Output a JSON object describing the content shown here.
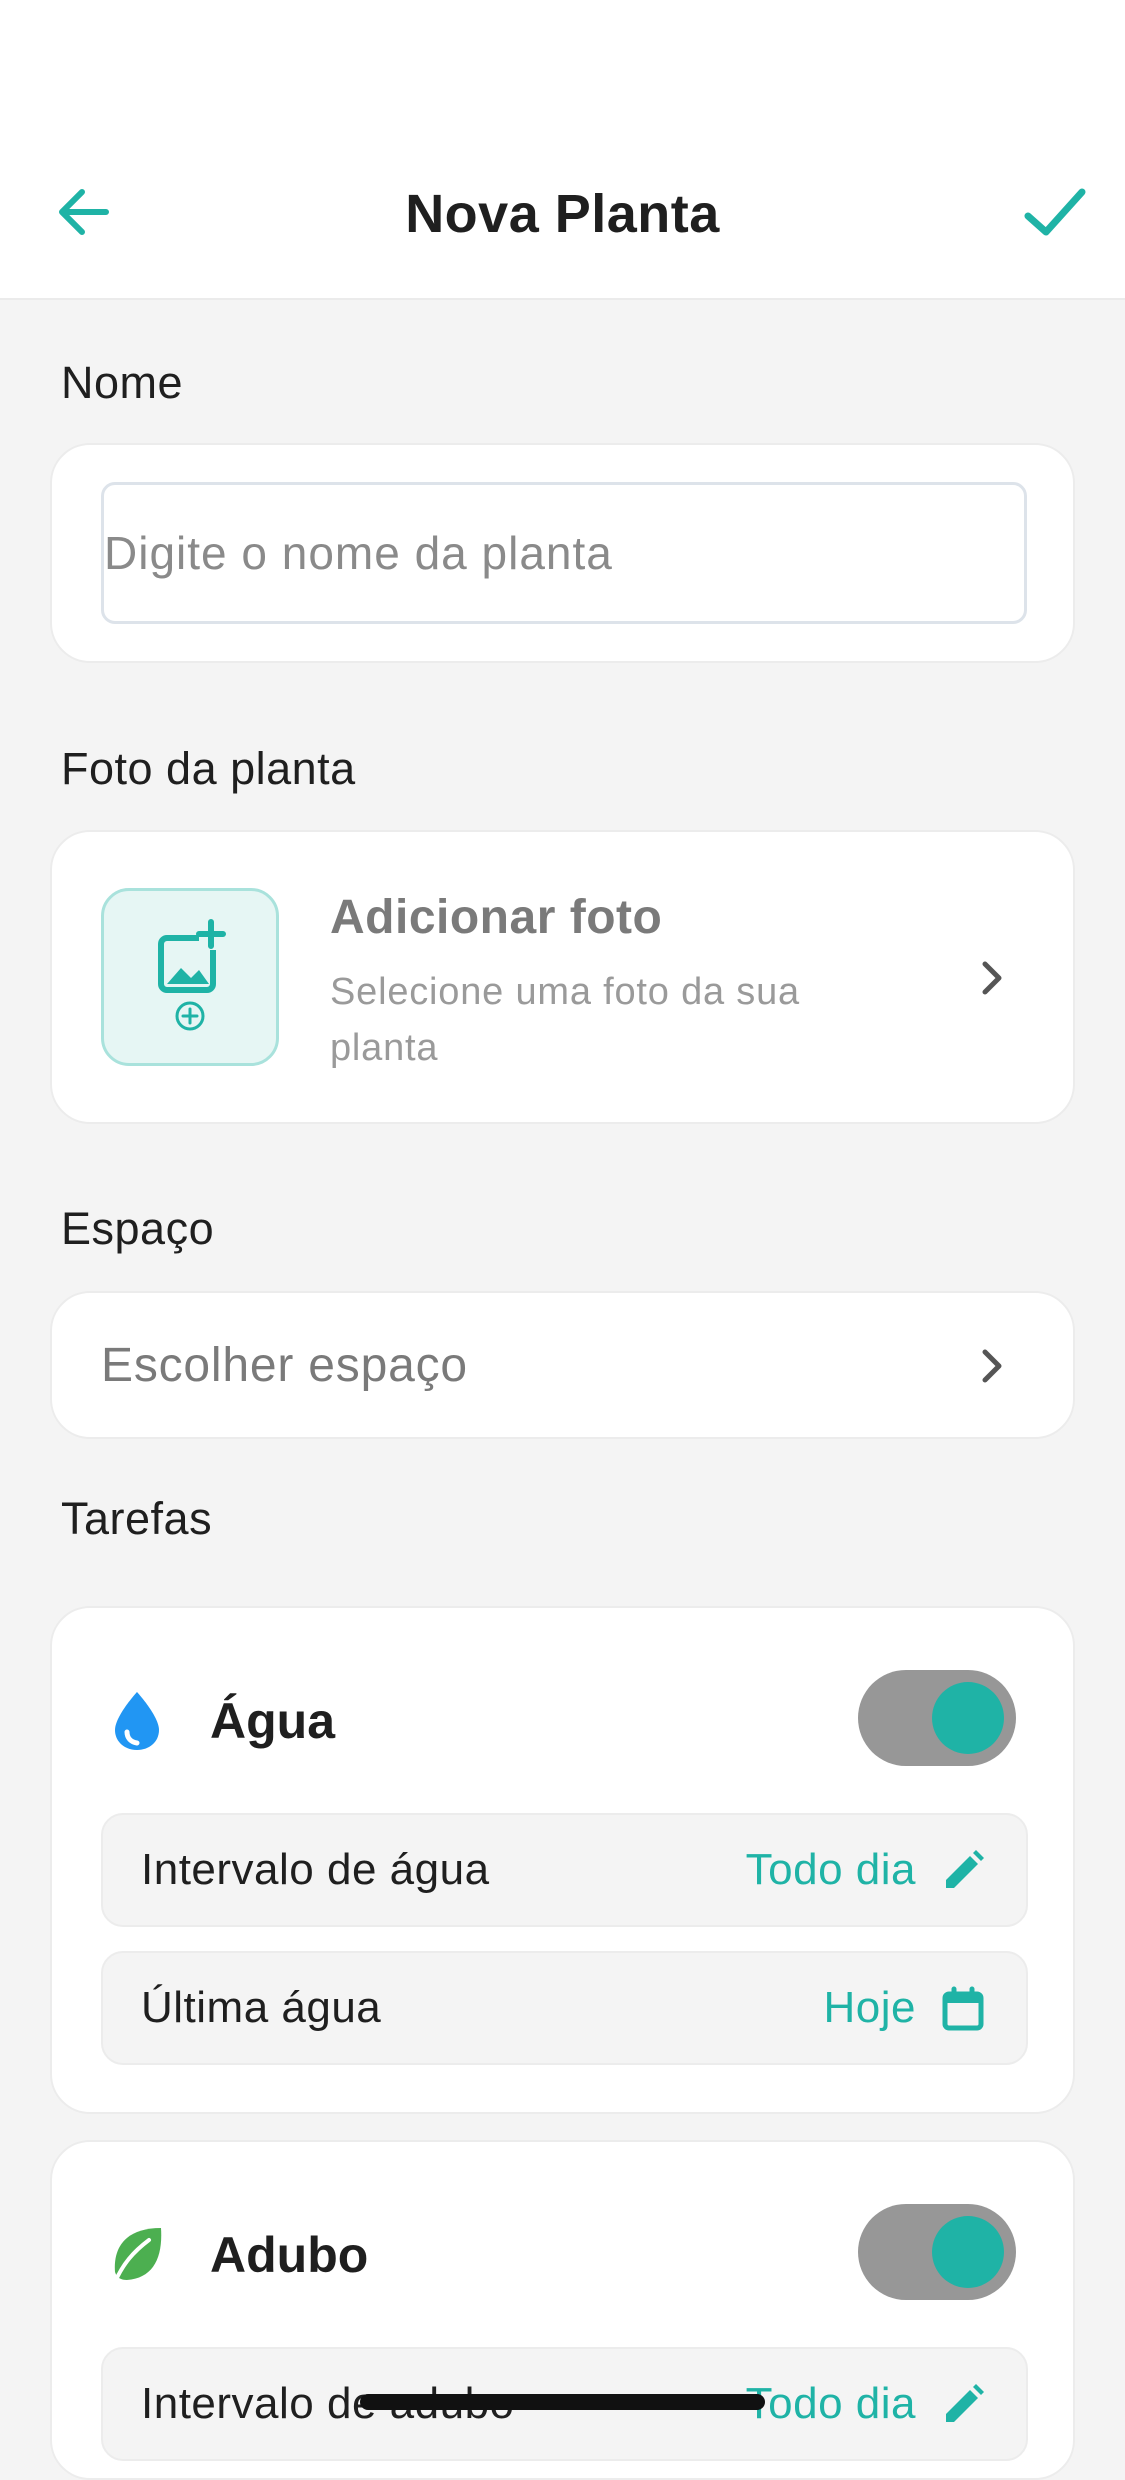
{
  "header": {
    "title": "Nova Planta",
    "back_icon": "arrow-left-icon",
    "confirm_icon": "check-icon"
  },
  "name_section": {
    "label": "Nome",
    "value": "",
    "placeholder": "Digite o nome da planta"
  },
  "photo_section": {
    "label": "Foto da planta",
    "title": "Adicionar foto",
    "subtitle": "Selecione uma foto da sua planta",
    "icon": "add-photo-icon"
  },
  "space_section": {
    "label": "Espaço",
    "placeholder": "Escolher espaço"
  },
  "tasks_section": {
    "label": "Tarefas",
    "tasks": [
      {
        "title": "Água",
        "icon": "water-drop-icon",
        "enabled": true,
        "rows": [
          {
            "label": "Intervalo de água",
            "value": "Todo dia",
            "icon": "pencil-icon"
          },
          {
            "label": "Última água",
            "value": "Hoje",
            "icon": "calendar-icon"
          }
        ]
      },
      {
        "title": "Adubo",
        "icon": "leaf-icon",
        "enabled": true,
        "rows": [
          {
            "label": "Intervalo de adubo",
            "value": "Todo dia",
            "icon": "pencil-icon"
          }
        ]
      }
    ]
  },
  "colors": {
    "accent": "#1fb3a6",
    "water": "#2196f3",
    "leaf": "#4caf50",
    "toggle_track": "#979797",
    "background": "#f4f4f4"
  }
}
